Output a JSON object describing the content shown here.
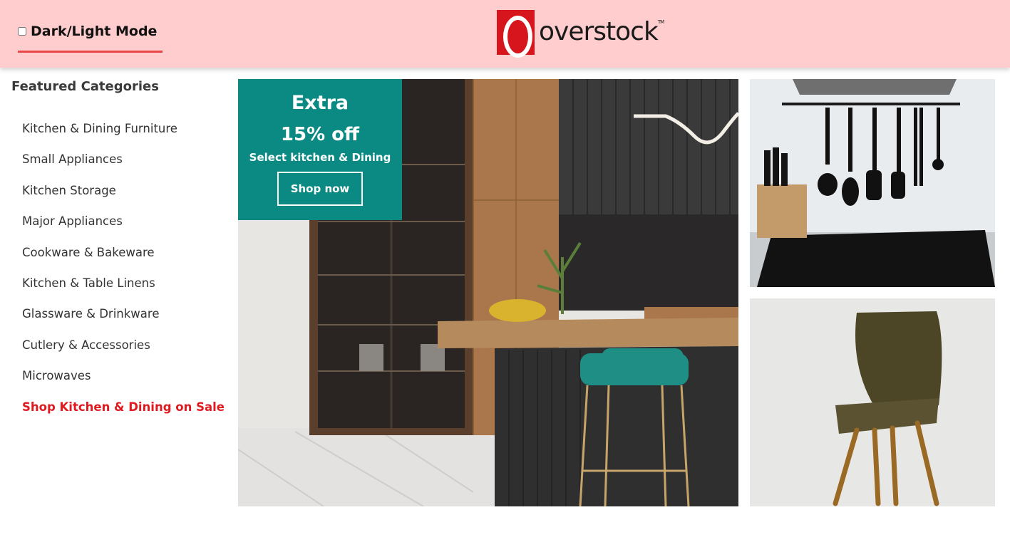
{
  "header": {
    "mode_toggle_label": "Dark/Light Mode",
    "logo_text": "overstock",
    "logo_tm": "TM",
    "brand_color": "#d7151c",
    "background_color": "#ffcdcd"
  },
  "sidebar": {
    "title": "Featured Categories",
    "items": [
      {
        "label": "Kitchen & Dining Furniture"
      },
      {
        "label": "Small Appliances"
      },
      {
        "label": "Kitchen Storage"
      },
      {
        "label": "Major Appliances"
      },
      {
        "label": "Cookware & Bakeware"
      },
      {
        "label": "Kitchen & Table Linens"
      },
      {
        "label": "Glassware & Drinkware"
      },
      {
        "label": "Cutlery & Accessories"
      },
      {
        "label": "Microwaves"
      },
      {
        "label": "Shop Kitchen & Dining on Sale"
      }
    ],
    "sale_color": "#e01a1f"
  },
  "promo": {
    "line1": "Extra",
    "line2": "15% off",
    "line3": "Select kitchen & Dining",
    "button_label": "Shop now",
    "color": "#0a8a82"
  }
}
